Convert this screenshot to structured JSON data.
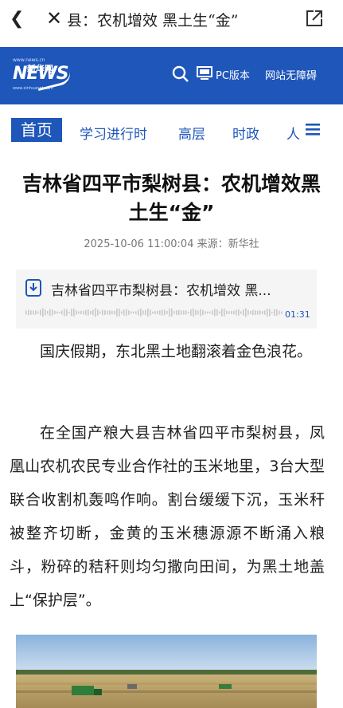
{
  "browser_bar": {
    "title": "县：农机增效 黑土生“金”"
  },
  "site": {
    "logo_url_text": "www.news.cn",
    "logo_brand_cn": "新华网",
    "logo_brand_en": "NEWS",
    "logo_sub_text": "www.xinhuanet.com",
    "pc_label": "PC版本",
    "accessibility_label": "网站无障碍"
  },
  "nav": {
    "items": [
      "首页",
      "学习进行时",
      "高层",
      "时政",
      "人"
    ]
  },
  "article": {
    "headline": "吉林省四平市梨树县：农机增效黑土生“金”",
    "meta": "2025-10-06 11:00:04 来源：新华社",
    "audio": {
      "title": "吉林省四平市梨树县：农机增效 黑...",
      "duration": "01:31"
    },
    "paragraphs": [
      "国庆假期，东北黑土地翻滚着金色浪花。",
      "在全国产粮大县吉林省四平市梨树县，凤凰山农机农民专业合作社的玉米地里，3台大型联合收割机轰鸣作响。割台缓缓下沉，玉米秆被整齐切断，金黄的玉米穗源源不断涌入粮斗，粉碎的秸秆则均匀撒向田间，为黑土地盖上“保护层”。"
    ]
  },
  "colors": {
    "brand_blue": "#1e56ba"
  }
}
